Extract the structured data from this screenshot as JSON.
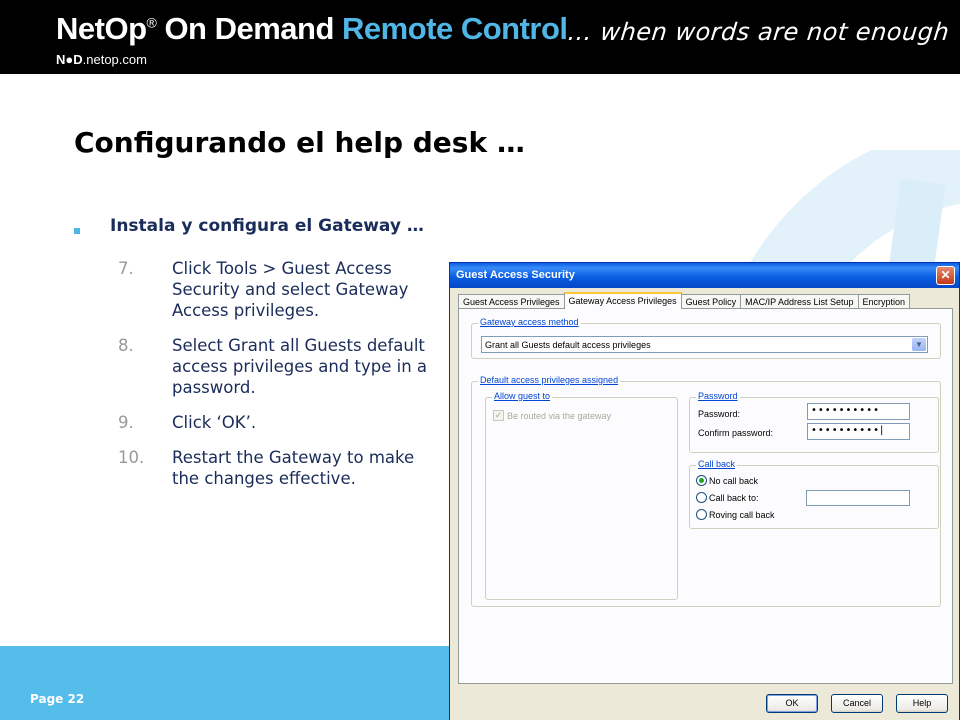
{
  "header": {
    "brand_netop": "NetOp",
    "brand_reg": "®",
    "brand_on_demand": " On Demand ",
    "brand_remote_control": "Remote Control",
    "tagline": "… when words are not enough",
    "site_prefix": "N●D",
    "site_suffix": ".netop.com"
  },
  "slide": {
    "title": "Configurando el help desk …",
    "subtitle": "Instala y configura el Gateway …",
    "steps": [
      {
        "num": "7.",
        "text": "Click Tools > Guest Access Security and select Gateway Access privileges."
      },
      {
        "num": "8.",
        "text": "Select Grant all Guests default access privileges and type in a password."
      },
      {
        "num": "9.",
        "text": "Click ‘OK’."
      },
      {
        "num": "10.",
        "text": "Restart the Gateway to make the changes effective."
      }
    ]
  },
  "footer": {
    "page": "Page 22"
  },
  "dialog": {
    "title": "Guest Access Security",
    "close": "✕",
    "tabs": [
      {
        "label": "Guest Access Privileges",
        "active": false
      },
      {
        "label": "Gateway Access Privileges",
        "active": true
      },
      {
        "label": "Guest Policy",
        "active": false
      },
      {
        "label": "MAC/IP Address List Setup",
        "active": false
      },
      {
        "label": "Encryption",
        "active": false
      }
    ],
    "method_group": "Gateway access method",
    "method_value": "Grant all Guests default access privileges",
    "defaults_group": "Default access privileges assigned",
    "allow_group": "Allow guest to",
    "allow_option": "Be routed via the gateway",
    "password_group": "Password",
    "password_label": "Password:",
    "password_value": "••••••••••",
    "confirm_label": "Confirm password:",
    "confirm_value": "••••••••••|",
    "callback_group": "Call back",
    "callback_options": [
      {
        "label": "No call back",
        "selected": true
      },
      {
        "label": "Call back to:",
        "selected": false
      },
      {
        "label": "Roving call back",
        "selected": false
      }
    ],
    "buttons": {
      "ok": "OK",
      "cancel": "Cancel",
      "help": "Help"
    }
  },
  "colors": {
    "accent_blue": "#54bde9",
    "title_text": "#000000",
    "body_text": "#1a2c5a",
    "dialog_bg": "#ece9d8",
    "titlebar": "#0a5ee5"
  }
}
